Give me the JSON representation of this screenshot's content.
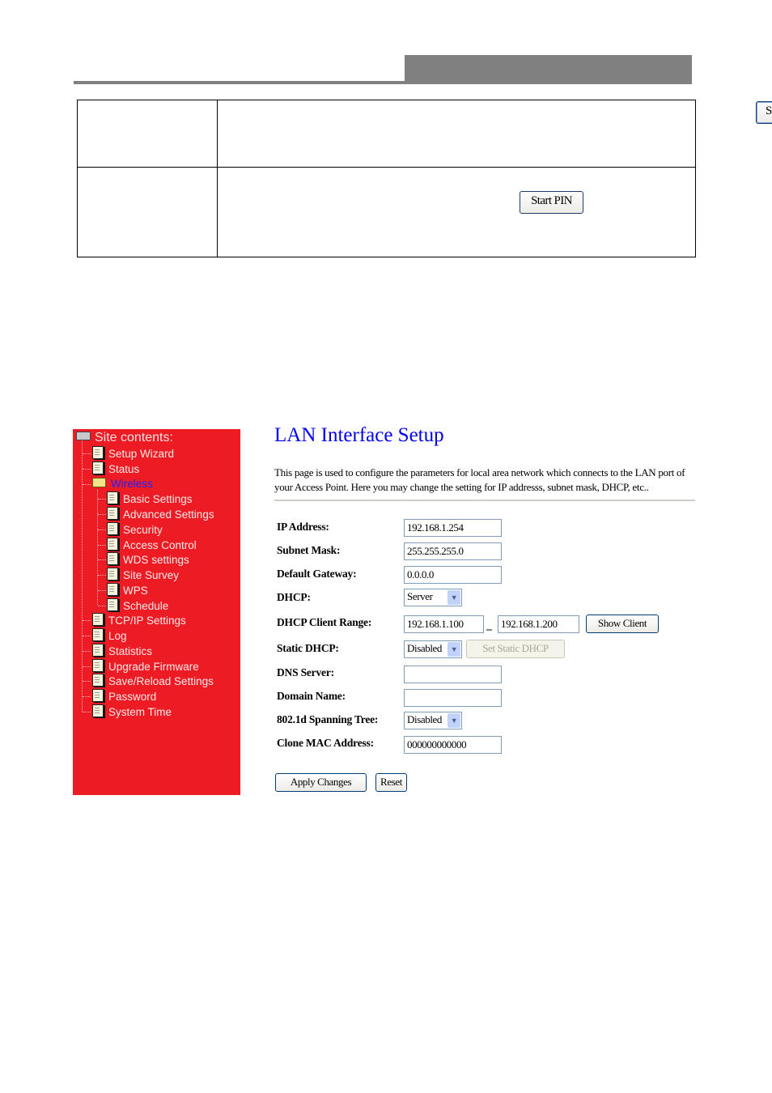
{
  "wps_table": {
    "rows": [
      {
        "button_label": "Start PBC"
      },
      {
        "button_label": "Start PIN"
      }
    ]
  },
  "sidebar": {
    "title": "Site contents:",
    "items": [
      {
        "label": "Setup Wizard",
        "level": 1,
        "icon": "document-icon"
      },
      {
        "label": "Status",
        "level": 1,
        "icon": "document-icon"
      },
      {
        "label": "Wireless",
        "level": 1,
        "icon": "folder-open-icon",
        "active": true
      },
      {
        "label": "Basic Settings",
        "level": 2,
        "icon": "document-icon"
      },
      {
        "label": "Advanced Settings",
        "level": 2,
        "icon": "document-icon"
      },
      {
        "label": "Security",
        "level": 2,
        "icon": "document-icon"
      },
      {
        "label": "Access Control",
        "level": 2,
        "icon": "document-icon"
      },
      {
        "label": "WDS settings",
        "level": 2,
        "icon": "document-icon"
      },
      {
        "label": "Site Survey",
        "level": 2,
        "icon": "document-icon"
      },
      {
        "label": "WPS",
        "level": 2,
        "icon": "document-icon"
      },
      {
        "label": "Schedule",
        "level": 2,
        "icon": "document-icon"
      },
      {
        "label": "TCP/IP Settings",
        "level": 1,
        "icon": "document-icon"
      },
      {
        "label": "Log",
        "level": 1,
        "icon": "document-icon"
      },
      {
        "label": "Statistics",
        "level": 1,
        "icon": "document-icon"
      },
      {
        "label": "Upgrade Firmware",
        "level": 1,
        "icon": "document-icon"
      },
      {
        "label": "Save/Reload Settings",
        "level": 1,
        "icon": "document-icon"
      },
      {
        "label": "Password",
        "level": 1,
        "icon": "document-icon"
      },
      {
        "label": "System Time",
        "level": 1,
        "icon": "document-icon"
      }
    ]
  },
  "main": {
    "title": "LAN Interface Setup",
    "description": "This page is used to configure the parameters for local area network which connects to the LAN port of your Access Point. Here you may change the setting for IP addresss, subnet mask, DHCP, etc..",
    "fields": {
      "ip_address": {
        "label": "IP Address:",
        "value": "192.168.1.254"
      },
      "subnet_mask": {
        "label": "Subnet Mask:",
        "value": "255.255.255.0"
      },
      "default_gateway": {
        "label": "Default Gateway:",
        "value": "0.0.0.0"
      },
      "dhcp": {
        "label": "DHCP:",
        "value": "Server"
      },
      "dhcp_client_range": {
        "label": "DHCP Client Range:",
        "start": "192.168.1.100",
        "separator": "–",
        "end": "192.168.1.200",
        "button": "Show Client"
      },
      "static_dhcp": {
        "label": "Static DHCP:",
        "value": "Disabled",
        "button": "Set Static DHCP"
      },
      "dns_server": {
        "label": "DNS Server:",
        "value": ""
      },
      "domain_name": {
        "label": "Domain Name:",
        "value": ""
      },
      "spanning_tree": {
        "label": "802.1d Spanning Tree:",
        "value": "Disabled"
      },
      "clone_mac": {
        "label": "Clone MAC Address:",
        "value": "000000000000"
      }
    },
    "buttons": {
      "apply": "Apply Changes",
      "reset": "Reset"
    }
  }
}
